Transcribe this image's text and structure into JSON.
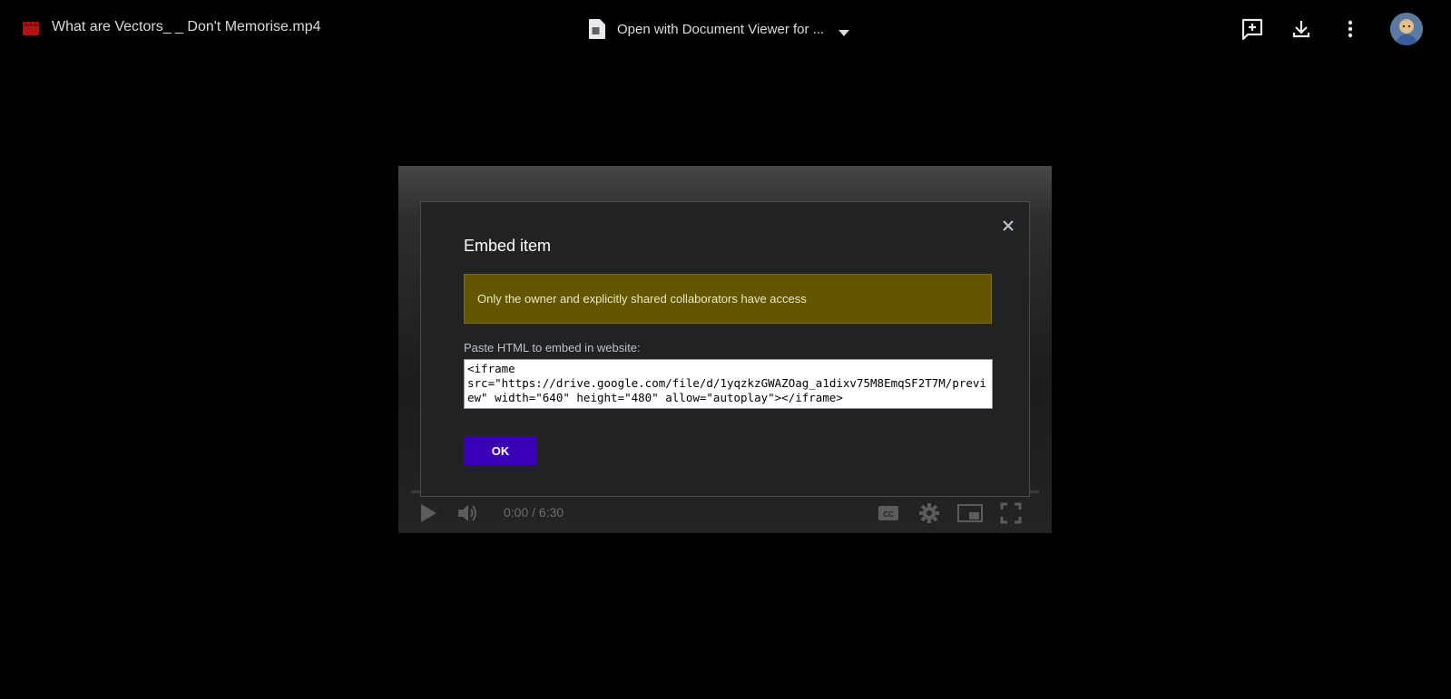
{
  "header": {
    "file_title": "What are Vectors_ _ Don't Memorise.mp4",
    "file_icon": "video-file-icon",
    "open_with_label": "Open with Document Viewer for ...",
    "actions": [
      "add-comment-icon",
      "download-icon",
      "more-vert-icon"
    ],
    "avatar": "avatar"
  },
  "player": {
    "time": "0:00 / 6:30",
    "controls": [
      "play-icon",
      "volume-icon",
      "captions-icon",
      "settings-icon",
      "miniplayer-icon",
      "fullscreen-icon"
    ]
  },
  "dialog": {
    "title": "Embed item",
    "notice": "Only the owner and explicitly shared collaborators have access",
    "embed_label": "Paste HTML to embed in website:",
    "embed_code": "<iframe src=\"https://drive.google.com/file/d/1yqzkzGWAZOag_a1dixv75M8EmqSF2T7M/preview\" width=\"640\" height=\"480\" allow=\"autoplay\"></iframe>",
    "ok_label": "OK"
  },
  "colors": {
    "background": "#000000",
    "notice_bg": "#625700",
    "ok_button": "#3a00b8",
    "dialog_bg": "#212224"
  }
}
